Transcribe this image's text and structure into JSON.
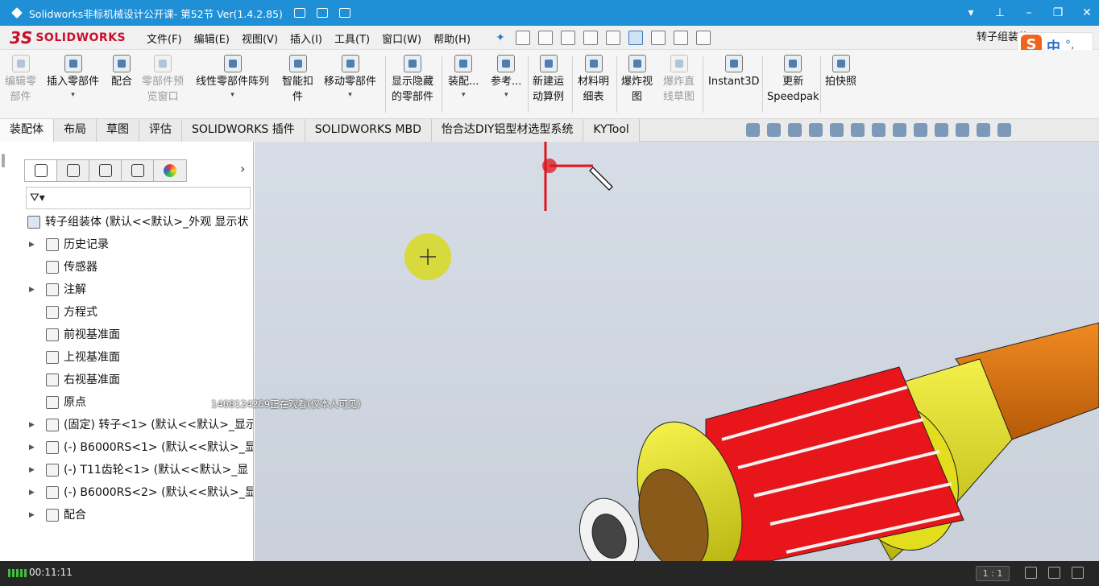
{
  "player": {
    "title": "Solidworks非标机械设计公开课- 第52节 Ver(1.4.2.85)",
    "elapsed_time": "00:11:11",
    "zoom_ratio": "1 : 1",
    "watch_overlay": "1468124259正在观看(仅本人可见)"
  },
  "app": {
    "logo_text": "SOLIDWORKS",
    "document_title": "转子组装体",
    "menu": [
      "文件(F)",
      "编辑(E)",
      "视图(V)",
      "插入(I)",
      "工具(T)",
      "窗口(W)",
      "帮助(H)"
    ]
  },
  "ime": {
    "logo": "S",
    "mode": "中",
    "punct": "°,"
  },
  "ribbon": {
    "commands": [
      {
        "label1": "编辑零",
        "label2": "部件",
        "disabled": true,
        "arrow": false
      },
      {
        "label1": "插入零部件",
        "label2": "",
        "disabled": false,
        "arrow": true
      },
      {
        "label1": "配合",
        "label2": "",
        "disabled": false,
        "arrow": false
      },
      {
        "label1": "零部件预",
        "label2": "览窗口",
        "disabled": true,
        "arrow": false
      },
      {
        "label1": "线性零部件阵列",
        "label2": "",
        "disabled": false,
        "arrow": true
      },
      {
        "label1": "智能扣",
        "label2": "件",
        "disabled": false,
        "arrow": false
      },
      {
        "label1": "移动零部件",
        "label2": "",
        "disabled": false,
        "arrow": true
      },
      {
        "label1": "显示隐藏",
        "label2": "的零部件",
        "disabled": false,
        "arrow": false
      },
      {
        "label1": "装配...",
        "label2": "",
        "disabled": false,
        "arrow": true
      },
      {
        "label1": "参考...",
        "label2": "",
        "disabled": false,
        "arrow": true
      },
      {
        "label1": "新建运",
        "label2": "动算例",
        "disabled": false,
        "arrow": false
      },
      {
        "label1": "材料明",
        "label2": "细表",
        "disabled": false,
        "arrow": false
      },
      {
        "label1": "爆炸视",
        "label2": "图",
        "disabled": false,
        "arrow": false
      },
      {
        "label1": "爆炸直",
        "label2": "线草图",
        "disabled": true,
        "arrow": false
      },
      {
        "label1": "Instant3D",
        "label2": "",
        "disabled": false,
        "arrow": false
      },
      {
        "label1": "更新",
        "label2": "Speedpak",
        "disabled": false,
        "arrow": false
      },
      {
        "label1": "拍快照",
        "label2": "",
        "disabled": false,
        "arrow": false
      }
    ]
  },
  "tabs": [
    "装配体",
    "布局",
    "草图",
    "评估",
    "SOLIDWORKS 插件",
    "SOLIDWORKS MBD",
    "怡合达DIY铝型材选型系统",
    "KYTool"
  ],
  "active_tab": "装配体",
  "feature_tree": {
    "filter_icon": "filter-icon",
    "root": "转子组装体  (默认<<默认>_外观 显示状",
    "items": [
      {
        "label": "历史记录",
        "expandable": true
      },
      {
        "label": "传感器",
        "expandable": false
      },
      {
        "label": "注解",
        "expandable": true
      },
      {
        "label": "方程式",
        "expandable": false
      },
      {
        "label": "前视基准面",
        "expandable": false
      },
      {
        "label": "上视基准面",
        "expandable": false
      },
      {
        "label": "右视基准面",
        "expandable": false
      },
      {
        "label": "原点",
        "expandable": false
      },
      {
        "label": "(固定) 转子<1> (默认<<默认>_显示",
        "expandable": true
      },
      {
        "label": "(-) B6000RS<1> (默认<<默认>_显",
        "expandable": true
      },
      {
        "label": "(-) T11齿轮<1> (默认<<默认>_显",
        "expandable": true
      },
      {
        "label": "(-) B6000RS<2> (默认<<默认>_显",
        "expandable": true
      },
      {
        "label": "配合",
        "expandable": true
      }
    ]
  },
  "colors": {
    "title_bar": "#1f8fd6",
    "rotor_red": "#e8161a",
    "rotor_yellow": "#e8e414",
    "orange_part": "#d9710e",
    "annotation_red": "#e0141e",
    "cursor_highlight": "#d8d820"
  }
}
